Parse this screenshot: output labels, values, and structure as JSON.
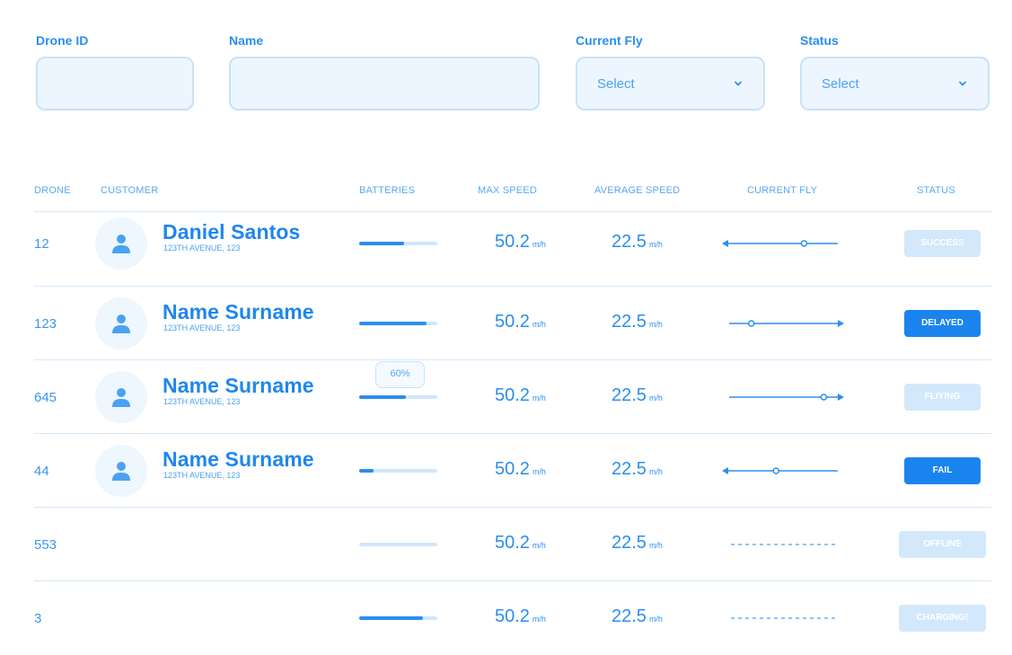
{
  "filters": {
    "drone_id": {
      "label": "Drone ID",
      "value": ""
    },
    "name": {
      "label": "Name",
      "value": ""
    },
    "current_fly": {
      "label": "Current Fly",
      "selected": "Select",
      "icon": "chevron-down-icon"
    },
    "status": {
      "label": "Status",
      "selected": "Select",
      "icon": "chevron-down-icon"
    }
  },
  "table": {
    "headers": {
      "drone": "DRONE",
      "customer": "CUSTOMER",
      "batteries": "BATTERIES",
      "max_speed": "MAX SPEED",
      "average_speed": "AVERAGE SPEED",
      "current_fly": "CURRENT FLY",
      "status": "STATUS"
    },
    "rows": [
      {
        "drone": "12",
        "customer_name": "Daniel Santos",
        "customer_address": "123TH AVENUE, 123",
        "battery_level": 0.58,
        "max_speed": "50.2",
        "max_speed_unit": "m/h",
        "avg_speed": "22.5",
        "avg_speed_unit": "m/h",
        "fly_direction": "left",
        "fly_progress": 0.7,
        "status": "SUCCESS",
        "status_style": "light"
      },
      {
        "drone": "123",
        "customer_name": "Name Surname",
        "customer_address": "123TH AVENUE, 123",
        "battery_level": 0.86,
        "max_speed": "50.2",
        "max_speed_unit": "m/h",
        "avg_speed": "22.5",
        "avg_speed_unit": "m/h",
        "fly_direction": "right",
        "fly_progress": 0.2,
        "status": "DELAYED",
        "status_style": "dark"
      },
      {
        "drone": "645",
        "customer_name": "Name Surname",
        "customer_address": "123TH AVENUE, 123",
        "battery_level": 0.6,
        "battery_tooltip": "60%",
        "max_speed": "50.2",
        "max_speed_unit": "m/h",
        "avg_speed": "22.5",
        "avg_speed_unit": "m/h",
        "fly_direction": "right",
        "fly_progress": 0.85,
        "status": "FLIYING",
        "status_style": "light"
      },
      {
        "drone": "44",
        "customer_name": "Name Surname",
        "customer_address": "123TH AVENUE, 123",
        "battery_level": 0.18,
        "max_speed": "50.2",
        "max_speed_unit": "m/h",
        "avg_speed": "22.5",
        "avg_speed_unit": "m/h",
        "fly_direction": "left",
        "fly_progress": 0.45,
        "status": "FAIL",
        "status_style": "dark"
      },
      {
        "drone": "553",
        "customer_name": "",
        "customer_address": "",
        "battery_level": 0.0,
        "max_speed": "50.2",
        "max_speed_unit": "m/h",
        "avg_speed": "22.5",
        "avg_speed_unit": "m/h",
        "fly_direction": "none",
        "status": "OFFLINE",
        "status_style": "light"
      },
      {
        "drone": "3",
        "customer_name": "",
        "customer_address": "",
        "battery_level": 0.82,
        "max_speed": "50.2",
        "max_speed_unit": "m/h",
        "avg_speed": "22.5",
        "avg_speed_unit": "m/h",
        "fly_direction": "none",
        "status": "CHARGING!",
        "status_style": "light"
      }
    ]
  },
  "colors": {
    "accent": "#2a8ef0",
    "accent_dark": "#1a84ee",
    "muted": "#d3e8fb",
    "field_bg": "#edf6fe",
    "field_border": "#c7e2fb"
  }
}
